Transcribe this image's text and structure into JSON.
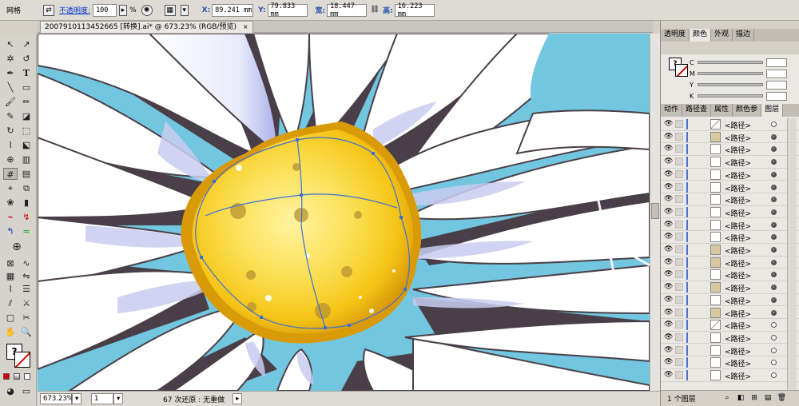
{
  "control_bar": {
    "label": "网格",
    "opacity_label": "不透明度:",
    "opacity_value": "100",
    "opacity_unit": "%",
    "x_label": "X:",
    "x_value": "89.241 mm",
    "y_label": "Y:",
    "y_value": "79.833 mm",
    "width_label": "宽:",
    "width_value": "18.447 mm",
    "height_label": "高:",
    "height_value": "16.223 mm"
  },
  "document_tab": {
    "title": "20079101134526​65 [转换].ai* @ 673.23% (RGB/预览)",
    "close": "×"
  },
  "status_bar": {
    "zoom": "673.23%",
    "page": "1",
    "message": "67 次还原 : 无重做"
  },
  "panels": {
    "top_tabs": [
      "透明度",
      "颜色",
      "外观",
      "描边"
    ],
    "color_labels": [
      "C",
      "M",
      "Y",
      "K"
    ],
    "layer_tabs": [
      "动作",
      "路径查",
      "属性",
      "颜色参",
      "图层"
    ],
    "layer_item_label": "<路径>",
    "layer_count": "1 个图层"
  },
  "colors": {
    "sky": "#72c6df",
    "petal": "#ffffff",
    "petal_shadow": "#c8cdf0",
    "outline": "#4a3f48",
    "center_light": "#fff08a",
    "center_mid": "#f9d230",
    "center_dark": "#d99a08",
    "path_selection": "#3a6fd8"
  }
}
